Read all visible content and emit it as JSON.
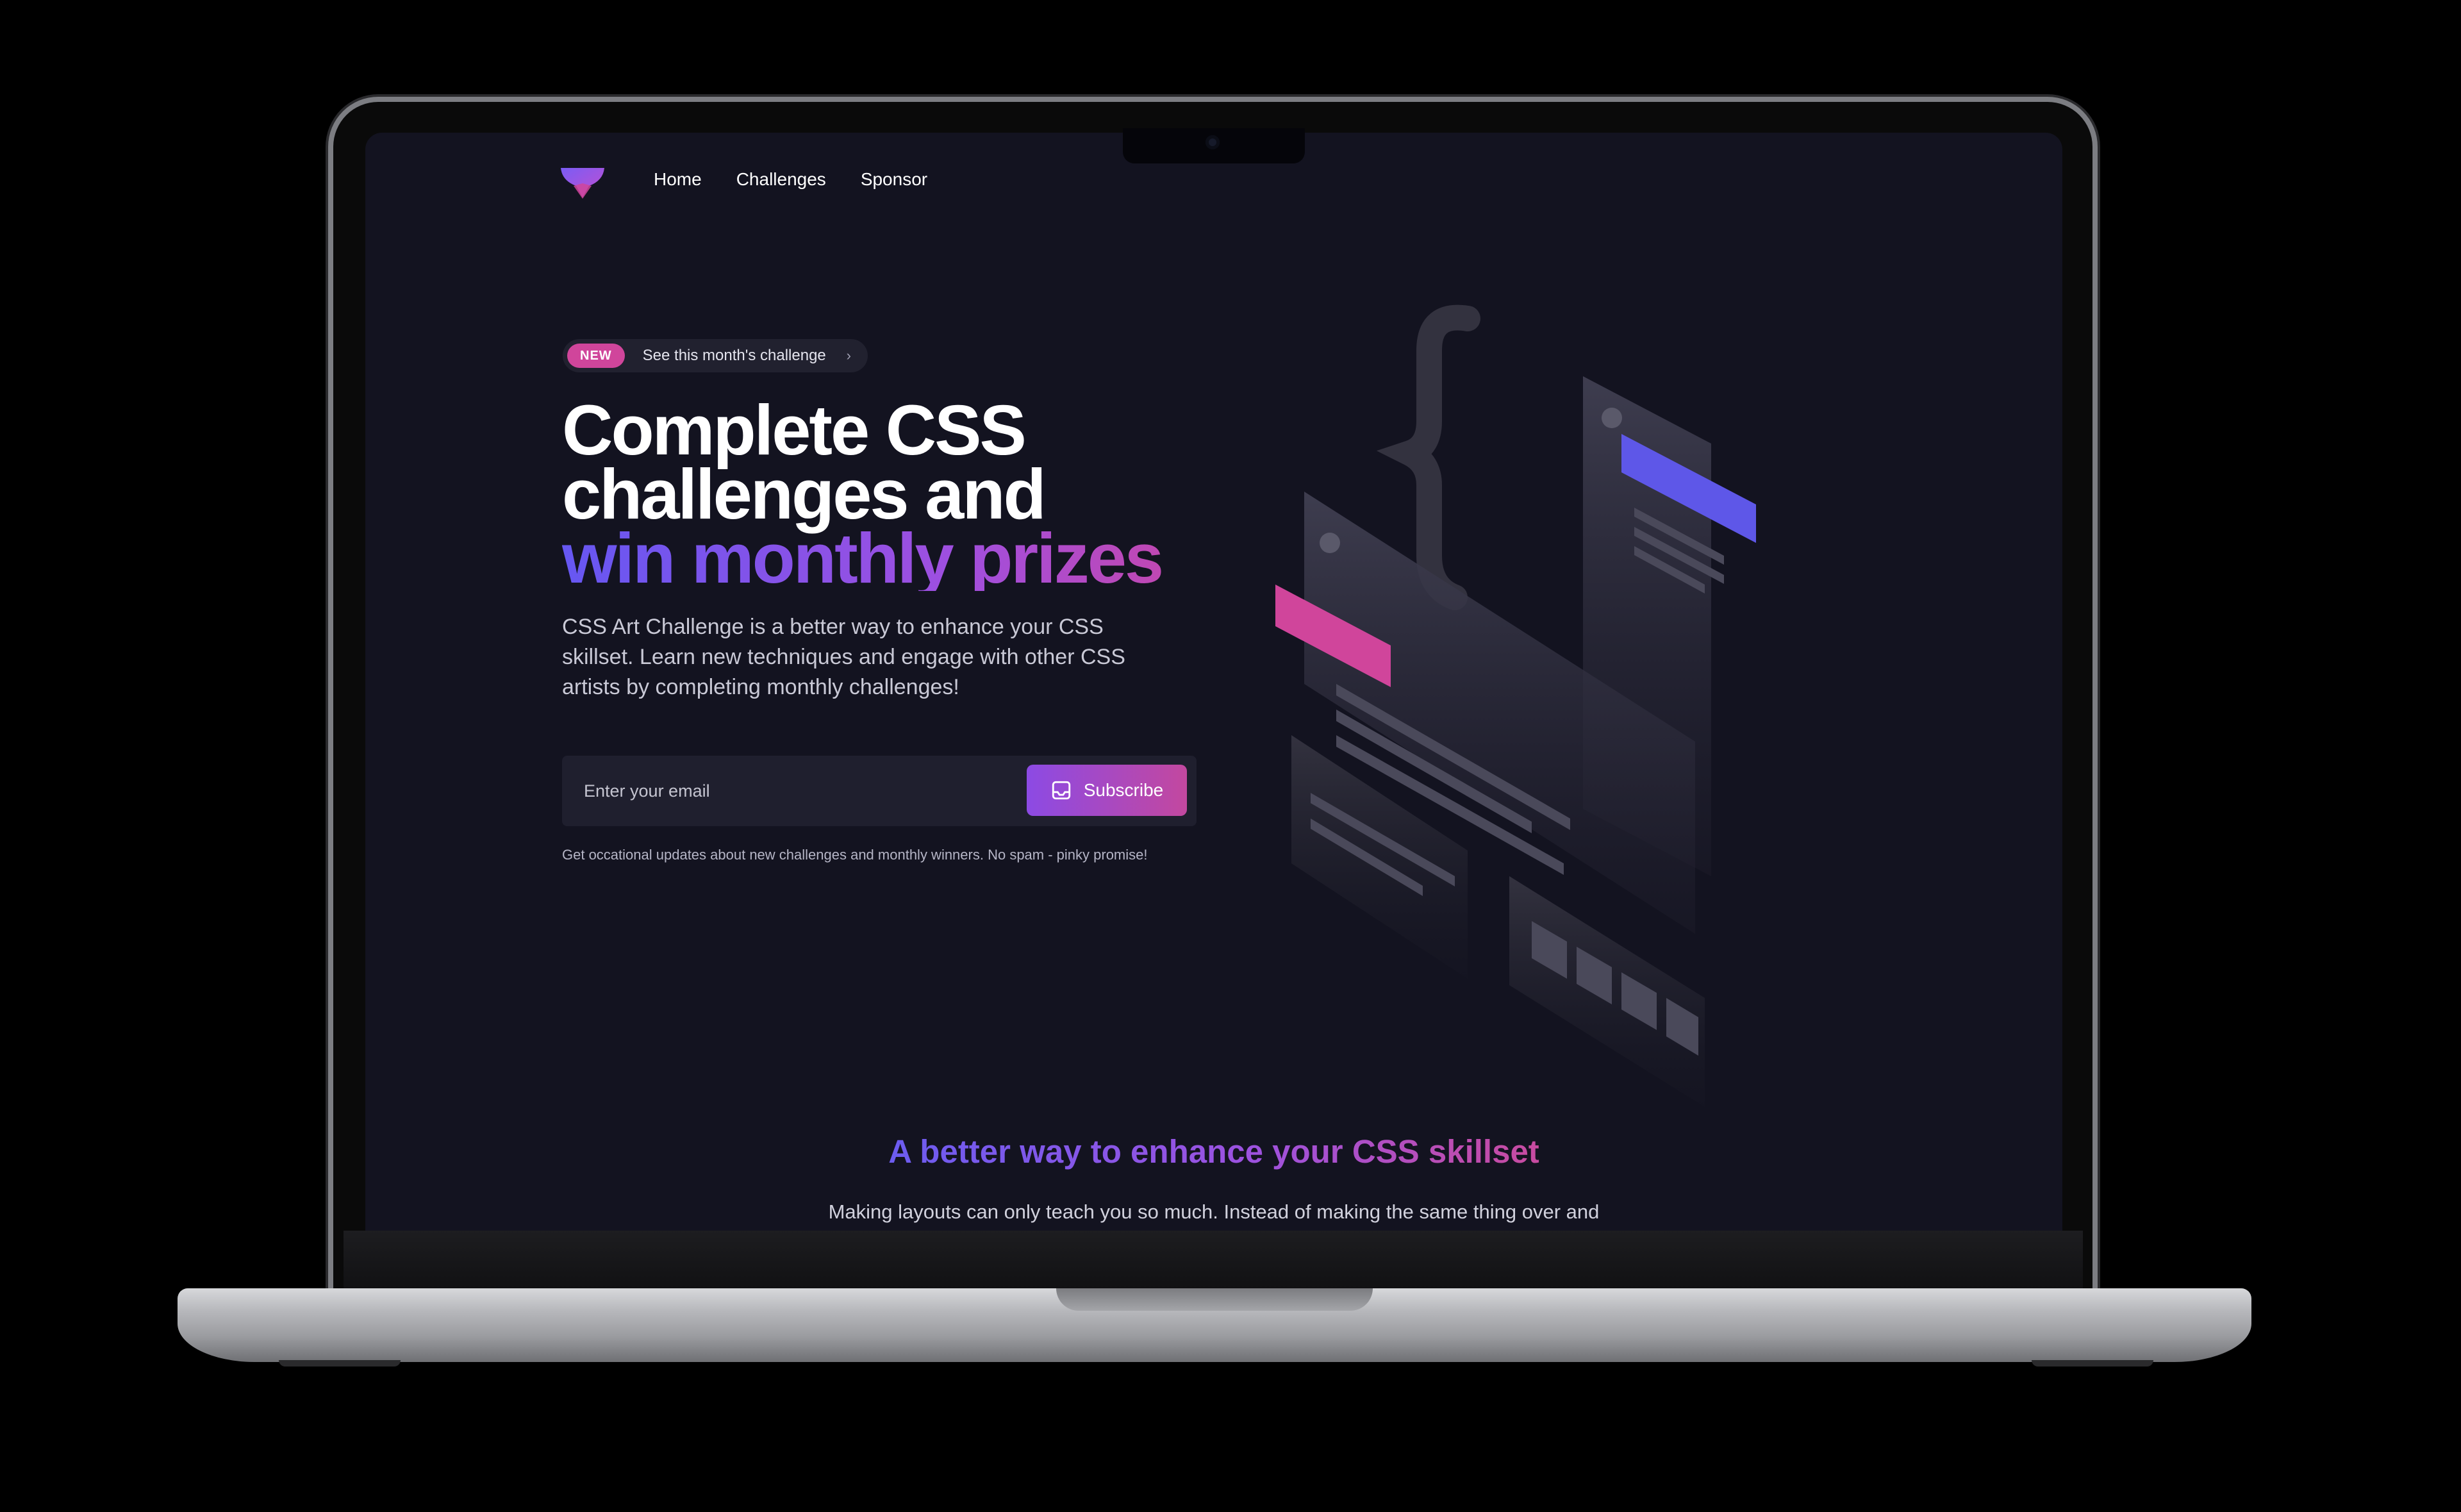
{
  "nav": {
    "links": [
      "Home",
      "Challenges",
      "Sponsor"
    ]
  },
  "hero": {
    "badge": "NEW",
    "announcement": "See this month's challenge",
    "announcement_chevron": "›",
    "title_line1": "Complete CSS",
    "title_line2": "challenges and",
    "title_line3": "win monthly prizes",
    "lead": "CSS Art Challenge is a better way to enhance your CSS skillset. Learn new techniques and engage with other CSS artists by completing monthly challenges!",
    "email_placeholder": "Enter your email",
    "subscribe_label": "Subscribe",
    "fine_print": "Get occational updates about new challenges and monthly winners. No spam - pinky promise!"
  },
  "section": {
    "title": "A better way to enhance your CSS skillset",
    "text": "Making layouts can only teach you so much. Instead of making the same thing over and"
  },
  "colors": {
    "screen_bg": "#131320",
    "accent_pink": "#d0459b",
    "accent_purple": "#8c4ae4",
    "accent_indigo": "#6657f2"
  },
  "icons": [
    "logo-icon",
    "inbox-icon",
    "chevron-right-icon",
    "camera-icon"
  ]
}
